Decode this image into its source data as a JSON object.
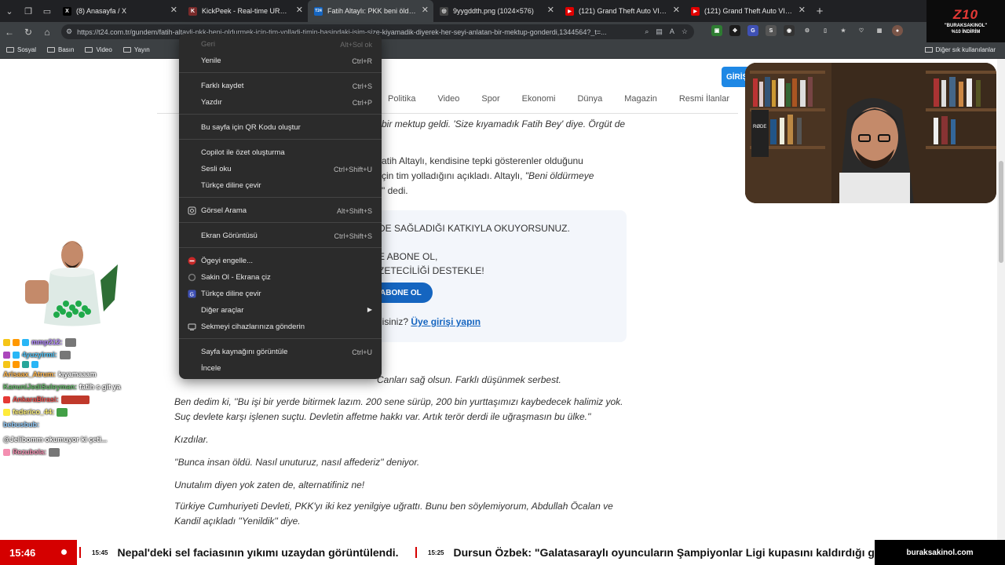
{
  "tabs": [
    {
      "title": "(8) Anasayfa / X",
      "favicon": "X",
      "color": "#000000"
    },
    {
      "title": "KickPeek - Real-time URL Crawler",
      "favicon": "K",
      "color": "#7a2b2b"
    },
    {
      "title": "Fatih Altaylı: PKK beni öldürmek iç",
      "favicon": "T24",
      "color": "#1565c0"
    },
    {
      "title": "9yygddth.png (1024×576)",
      "favicon": "◎",
      "color": "#444444"
    },
    {
      "title": "(121) Grand Theft Auto VI – Detay",
      "favicon": "▶",
      "color": "#e00000"
    },
    {
      "title": "(121) Grand Theft Auto VI – Detay",
      "favicon": "▶",
      "color": "#e00000"
    }
  ],
  "promo": {
    "logo": "Z10",
    "code": "\"BURAKSAKINOL\"",
    "discount": "%10 İNDİRİM"
  },
  "address_bar": {
    "url": "https://t24.com.tr/gundem/fatih-altayli-pkk-beni-oldurmek-icin-tim-yolladi-timin-basindaki-isim-size-kiyamadik-diyerek-her-seyi-anlatan-bir-mektup-gonderdi,1344564?_t=..."
  },
  "bookmarks": [
    {
      "label": "Sosyal"
    },
    {
      "label": "Basın"
    },
    {
      "label": "Video"
    },
    {
      "label": "Yayın"
    }
  ],
  "bookmarks_other": "Diğer sık kullanılanlar",
  "site": {
    "login_label": "GİRİŞ",
    "nav": [
      "Politika",
      "Video",
      "Spor",
      "Ekonomi",
      "Dünya",
      "Magazin",
      "Resmi İlanlar"
    ]
  },
  "article": {
    "p1": "bir mektup geldi. 'Size kıyamadık Fatih Bey' diye. Örgüt de",
    "p2a": "atih Altaylı, kendisine tepki gösterenler olduğunu",
    "p2b": "çin tim yolladığını açıkladı. Altaylı,",
    "p2b_quote": "\"Beni öldürmeye",
    "p2c": "\" dedi.",
    "p3": "Canları sağ olsun. Farklı düşünmek serbest.",
    "p4a": "Ben dedim ki, ''Bu işi bir yerde bitirmek lazım. 200 sene sürüp, 200 bin yurttaşımızı kaybedecek halimiz yok.",
    "p4b": "Suç devlete karşı işlenen suçtu. Devletin affetme hakkı var. Artık terör derdi ile uğraşmasın bu ülke.''",
    "p5": "Kızdılar.",
    "p6": "''Bunca insan öldü. Nasıl unuturuz, nasıl affederiz'' deniyor.",
    "p7": "Unutalım diyen yok zaten de, alternatifiniz ne!",
    "p8a": "Türkiye Cumhuriyeti Devleti, PKK'yı iki kez yenilgiye uğrattı. Bunu ben söylemiyorum, Abdullah Öcalan ve",
    "p8b": "Kandil açıkladı ''Yenildik'' diye."
  },
  "subscribe": {
    "line1": "DE SAĞLADIĞI KATKIYLA OKUYORSUNUZ.",
    "line2": "E ABONE OL,",
    "line3": "ZETECİLİĞİ DESTEKLE!",
    "button": "ABONE OL",
    "member_text": "nisiniz?",
    "member_link": "Üye girişi yapın"
  },
  "context_menu": {
    "items": [
      {
        "label": "Geri",
        "shortcut": "Alt+Sol ok",
        "disabled": true
      },
      {
        "label": "Yenile",
        "shortcut": "Ctrl+R"
      },
      {
        "label": "Farklı kaydet",
        "shortcut": "Ctrl+S"
      },
      {
        "label": "Yazdır",
        "shortcut": "Ctrl+P"
      },
      {
        "label": "Bu sayfa için QR Kodu oluştur",
        "shortcut": ""
      },
      {
        "label": "Copilot ile özet oluşturma",
        "shortcut": ""
      },
      {
        "label": "Sesli oku",
        "shortcut": "Ctrl+Shift+U"
      },
      {
        "label": "Türkçe diline çevir",
        "shortcut": ""
      },
      {
        "label": "Görsel Arama",
        "shortcut": "Alt+Shift+S"
      },
      {
        "label": "Ekran Görüntüsü",
        "shortcut": "Ctrl+Shift+S"
      },
      {
        "label": "Ögeyi engelle...",
        "shortcut": ""
      },
      {
        "label": "Sakin Ol - Ekrana çiz",
        "shortcut": ""
      },
      {
        "label": "Türkçe diline çevir",
        "shortcut": ""
      },
      {
        "label": "Diğer araçlar",
        "shortcut": ""
      },
      {
        "label": "Sekmeyi cihazlarınıza gönderin",
        "shortcut": ""
      },
      {
        "label": "Sayfa kaynağını görüntüle",
        "shortcut": "Ctrl+U"
      },
      {
        "label": "İncele",
        "shortcut": ""
      }
    ]
  },
  "chat": [
    {
      "user": "mmp212:",
      "msg": ""
    },
    {
      "user": "4yuzyirmi:",
      "msg": ""
    },
    {
      "user": "Arisaax_Atrum:",
      "msg": "kıyamaaam"
    },
    {
      "user": "KanuniJediSuleyman:",
      "msg": "fatih s git ya"
    },
    {
      "user": "AnkaraBirasi:",
      "msg": ""
    },
    {
      "user": "federico_44:",
      "msg": ""
    },
    {
      "user": "bebusbub:",
      "msg": "@Jelibomm okumuyor ki çeti..."
    },
    {
      "user": "Rezubola:",
      "msg": ""
    }
  ],
  "ticker": {
    "clock": "15:46",
    "items": [
      {
        "time": "15:45",
        "text": "Nepal'deki sel faciasının yıkımı uzaydan görüntülendi."
      },
      {
        "time": "15:25",
        "text": "Dursun Özbek: \"Galatasaraylı oyuncuların Şampiyonlar Ligi kupasını kaldırdığı gü"
      }
    ],
    "site": "buraksakinol.com"
  },
  "colors": {
    "accent": "#1565c0",
    "chrome_dark": "#202124",
    "menu_bg": "#2b2b2b",
    "ticker_red": "#d50000"
  }
}
